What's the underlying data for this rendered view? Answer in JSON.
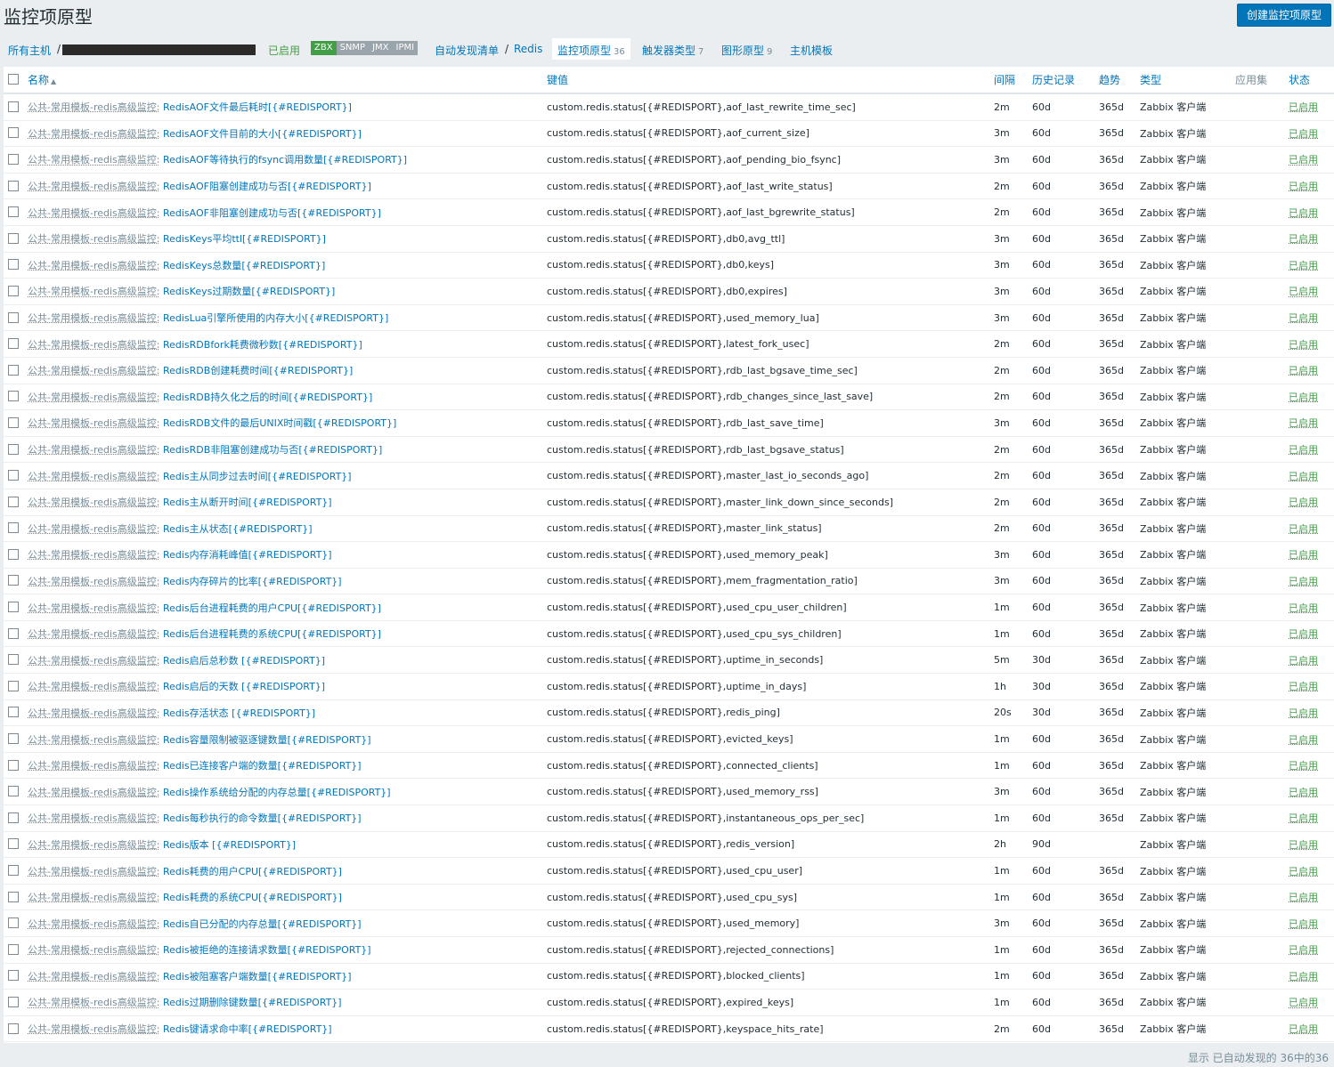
{
  "page": {
    "title": "监控项原型",
    "create_button": "创建监控项原型"
  },
  "nav": {
    "all_hosts": "所有主机",
    "slash": "/",
    "enabled": "已启用",
    "availability": [
      "ZBX",
      "SNMP",
      "JMX",
      "IPMI"
    ],
    "discovery_list": "自动发现清单",
    "discovery_rule": "Redis",
    "item_prototypes": "监控项原型",
    "item_prototypes_count": "36",
    "trigger_prototypes": "触发器类型",
    "trigger_prototypes_count": "7",
    "graph_prototypes": "图形原型",
    "graph_prototypes_count": "9",
    "host_prototypes": "主机模板"
  },
  "table": {
    "headers": {
      "name": "名称",
      "key": "键值",
      "interval": "间隔",
      "history": "历史记录",
      "trends": "趋势",
      "type": "类型",
      "applications": "应用集",
      "status": "状态"
    },
    "prefix": "公共-常用模板-redis高级监控:",
    "rows": [
      {
        "name": "RedisAOF文件最后耗时[{#REDISPORT}]",
        "key": "custom.redis.status[{#REDISPORT},aof_last_rewrite_time_sec]",
        "interval": "2m",
        "history": "60d",
        "trends": "365d",
        "type": "Zabbix 客户端",
        "status": "已启用"
      },
      {
        "name": "RedisAOF文件目前的大小[{#REDISPORT}]",
        "key": "custom.redis.status[{#REDISPORT},aof_current_size]",
        "interval": "3m",
        "history": "60d",
        "trends": "365d",
        "type": "Zabbix 客户端",
        "status": "已启用"
      },
      {
        "name": "RedisAOF等待执行的fsync调用数量[{#REDISPORT}]",
        "key": "custom.redis.status[{#REDISPORT},aof_pending_bio_fsync]",
        "interval": "3m",
        "history": "60d",
        "trends": "365d",
        "type": "Zabbix 客户端",
        "status": "已启用"
      },
      {
        "name": "RedisAOF阻塞创建成功与否[{#REDISPORT}]",
        "key": "custom.redis.status[{#REDISPORT},aof_last_write_status]",
        "interval": "2m",
        "history": "60d",
        "trends": "365d",
        "type": "Zabbix 客户端",
        "status": "已启用"
      },
      {
        "name": "RedisAOF非阻塞创建成功与否[{#REDISPORT}]",
        "key": "custom.redis.status[{#REDISPORT},aof_last_bgrewrite_status]",
        "interval": "2m",
        "history": "60d",
        "trends": "365d",
        "type": "Zabbix 客户端",
        "status": "已启用"
      },
      {
        "name": "RedisKeys平均ttl[{#REDISPORT}]",
        "key": "custom.redis.status[{#REDISPORT},db0,avg_ttl]",
        "interval": "3m",
        "history": "60d",
        "trends": "365d",
        "type": "Zabbix 客户端",
        "status": "已启用"
      },
      {
        "name": "RedisKeys总数量[{#REDISPORT}]",
        "key": "custom.redis.status[{#REDISPORT},db0,keys]",
        "interval": "3m",
        "history": "60d",
        "trends": "365d",
        "type": "Zabbix 客户端",
        "status": "已启用"
      },
      {
        "name": "RedisKeys过期数量[{#REDISPORT}]",
        "key": "custom.redis.status[{#REDISPORT},db0,expires]",
        "interval": "3m",
        "history": "60d",
        "trends": "365d",
        "type": "Zabbix 客户端",
        "status": "已启用"
      },
      {
        "name": "RedisLua引擎所使用的内存大小[{#REDISPORT}]",
        "key": "custom.redis.status[{#REDISPORT},used_memory_lua]",
        "interval": "3m",
        "history": "60d",
        "trends": "365d",
        "type": "Zabbix 客户端",
        "status": "已启用"
      },
      {
        "name": "RedisRDBfork耗费微秒数[{#REDISPORT}]",
        "key": "custom.redis.status[{#REDISPORT},latest_fork_usec]",
        "interval": "2m",
        "history": "60d",
        "trends": "365d",
        "type": "Zabbix 客户端",
        "status": "已启用"
      },
      {
        "name": "RedisRDB创建耗费时间[{#REDISPORT}]",
        "key": "custom.redis.status[{#REDISPORT},rdb_last_bgsave_time_sec]",
        "interval": "2m",
        "history": "60d",
        "trends": "365d",
        "type": "Zabbix 客户端",
        "status": "已启用"
      },
      {
        "name": "RedisRDB持久化之后的时间[{#REDISPORT}]",
        "key": "custom.redis.status[{#REDISPORT},rdb_changes_since_last_save]",
        "interval": "2m",
        "history": "60d",
        "trends": "365d",
        "type": "Zabbix 客户端",
        "status": "已启用"
      },
      {
        "name": "RedisRDB文件的最后UNIX时间戳[{#REDISPORT}]",
        "key": "custom.redis.status[{#REDISPORT},rdb_last_save_time]",
        "interval": "3m",
        "history": "60d",
        "trends": "365d",
        "type": "Zabbix 客户端",
        "status": "已启用"
      },
      {
        "name": "RedisRDB非阻塞创建成功与否[{#REDISPORT}]",
        "key": "custom.redis.status[{#REDISPORT},rdb_last_bgsave_status]",
        "interval": "2m",
        "history": "60d",
        "trends": "365d",
        "type": "Zabbix 客户端",
        "status": "已启用"
      },
      {
        "name": "Redis主从同步过去时间[{#REDISPORT}]",
        "key": "custom.redis.status[{#REDISPORT},master_last_io_seconds_ago]",
        "interval": "2m",
        "history": "60d",
        "trends": "365d",
        "type": "Zabbix 客户端",
        "status": "已启用"
      },
      {
        "name": "Redis主从断开时间[{#REDISPORT}]",
        "key": "custom.redis.status[{#REDISPORT},master_link_down_since_seconds]",
        "interval": "2m",
        "history": "60d",
        "trends": "365d",
        "type": "Zabbix 客户端",
        "status": "已启用"
      },
      {
        "name": "Redis主从状态[{#REDISPORT}]",
        "key": "custom.redis.status[{#REDISPORT},master_link_status]",
        "interval": "2m",
        "history": "60d",
        "trends": "365d",
        "type": "Zabbix 客户端",
        "status": "已启用"
      },
      {
        "name": "Redis内存消耗峰值[{#REDISPORT}]",
        "key": "custom.redis.status[{#REDISPORT},used_memory_peak]",
        "interval": "3m",
        "history": "60d",
        "trends": "365d",
        "type": "Zabbix 客户端",
        "status": "已启用"
      },
      {
        "name": "Redis内存碎片的比率[{#REDISPORT}]",
        "key": "custom.redis.status[{#REDISPORT},mem_fragmentation_ratio]",
        "interval": "3m",
        "history": "60d",
        "trends": "365d",
        "type": "Zabbix 客户端",
        "status": "已启用"
      },
      {
        "name": "Redis后台进程耗费的用户CPU[{#REDISPORT}]",
        "key": "custom.redis.status[{#REDISPORT},used_cpu_user_children]",
        "interval": "1m",
        "history": "60d",
        "trends": "365d",
        "type": "Zabbix 客户端",
        "status": "已启用"
      },
      {
        "name": "Redis后台进程耗费的系统CPU[{#REDISPORT}]",
        "key": "custom.redis.status[{#REDISPORT},used_cpu_sys_children]",
        "interval": "1m",
        "history": "60d",
        "trends": "365d",
        "type": "Zabbix 客户端",
        "status": "已启用"
      },
      {
        "name": "Redis启后总秒数 [{#REDISPORT}]",
        "key": "custom.redis.status[{#REDISPORT},uptime_in_seconds]",
        "interval": "5m",
        "history": "30d",
        "trends": "365d",
        "type": "Zabbix 客户端",
        "status": "已启用"
      },
      {
        "name": "Redis启后的天数 [{#REDISPORT}]",
        "key": "custom.redis.status[{#REDISPORT},uptime_in_days]",
        "interval": "1h",
        "history": "30d",
        "trends": "365d",
        "type": "Zabbix 客户端",
        "status": "已启用"
      },
      {
        "name": "Redis存活状态 [{#REDISPORT}]",
        "key": "custom.redis.status[{#REDISPORT},redis_ping]",
        "interval": "20s",
        "history": "30d",
        "trends": "365d",
        "type": "Zabbix 客户端",
        "status": "已启用"
      },
      {
        "name": "Redis容量限制被驱逐键数量[{#REDISPORT}]",
        "key": "custom.redis.status[{#REDISPORT},evicted_keys]",
        "interval": "1m",
        "history": "60d",
        "trends": "365d",
        "type": "Zabbix 客户端",
        "status": "已启用"
      },
      {
        "name": "Redis已连接客户端的数量[{#REDISPORT}]",
        "key": "custom.redis.status[{#REDISPORT},connected_clients]",
        "interval": "1m",
        "history": "60d",
        "trends": "365d",
        "type": "Zabbix 客户端",
        "status": "已启用"
      },
      {
        "name": "Redis操作系统给分配的内存总量[{#REDISPORT}]",
        "key": "custom.redis.status[{#REDISPORT},used_memory_rss]",
        "interval": "3m",
        "history": "60d",
        "trends": "365d",
        "type": "Zabbix 客户端",
        "status": "已启用"
      },
      {
        "name": "Redis每秒执行的命令数量[{#REDISPORT}]",
        "key": "custom.redis.status[{#REDISPORT},instantaneous_ops_per_sec]",
        "interval": "1m",
        "history": "60d",
        "trends": "365d",
        "type": "Zabbix 客户端",
        "status": "已启用"
      },
      {
        "name": "Redis版本 [{#REDISPORT}]",
        "key": "custom.redis.status[{#REDISPORT},redis_version]",
        "interval": "2h",
        "history": "90d",
        "trends": "",
        "type": "Zabbix 客户端",
        "status": "已启用"
      },
      {
        "name": "Redis耗费的用户CPU[{#REDISPORT}]",
        "key": "custom.redis.status[{#REDISPORT},used_cpu_user]",
        "interval": "1m",
        "history": "60d",
        "trends": "365d",
        "type": "Zabbix 客户端",
        "status": "已启用"
      },
      {
        "name": "Redis耗费的系统CPU[{#REDISPORT}]",
        "key": "custom.redis.status[{#REDISPORT},used_cpu_sys]",
        "interval": "1m",
        "history": "60d",
        "trends": "365d",
        "type": "Zabbix 客户端",
        "status": "已启用"
      },
      {
        "name": "Redis自已分配的内存总量[{#REDISPORT}]",
        "key": "custom.redis.status[{#REDISPORT},used_memory]",
        "interval": "3m",
        "history": "60d",
        "trends": "365d",
        "type": "Zabbix 客户端",
        "status": "已启用"
      },
      {
        "name": "Redis被拒绝的连接请求数量[{#REDISPORT}]",
        "key": "custom.redis.status[{#REDISPORT},rejected_connections]",
        "interval": "1m",
        "history": "60d",
        "trends": "365d",
        "type": "Zabbix 客户端",
        "status": "已启用"
      },
      {
        "name": "Redis被阻塞客户端数量[{#REDISPORT}]",
        "key": "custom.redis.status[{#REDISPORT},blocked_clients]",
        "interval": "1m",
        "history": "60d",
        "trends": "365d",
        "type": "Zabbix 客户端",
        "status": "已启用"
      },
      {
        "name": "Redis过期删除键数量[{#REDISPORT}]",
        "key": "custom.redis.status[{#REDISPORT},expired_keys]",
        "interval": "1m",
        "history": "60d",
        "trends": "365d",
        "type": "Zabbix 客户端",
        "status": "已启用"
      },
      {
        "name": "Redis键请求命中率[{#REDISPORT}]",
        "key": "custom.redis.status[{#REDISPORT},keyspace_hits_rate]",
        "interval": "2m",
        "history": "60d",
        "trends": "365d",
        "type": "Zabbix 客户端",
        "status": "已启用"
      }
    ]
  },
  "footer": {
    "summary": "显示 已自动发现的 36中的36"
  },
  "colors": {
    "link": "#0275b8",
    "enabled": "#429e47",
    "muted": "#768d99",
    "background": "#ebeef0"
  }
}
